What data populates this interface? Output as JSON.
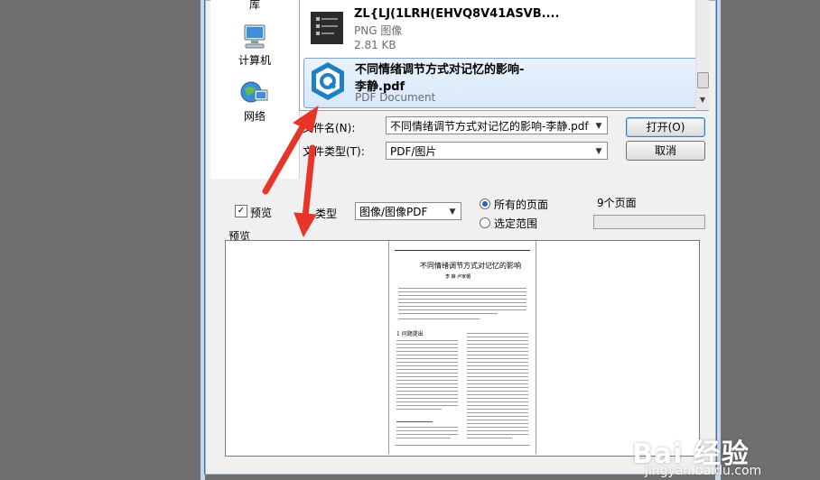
{
  "nav": {
    "items": [
      {
        "label": "库",
        "icon": "library-icon"
      },
      {
        "label": "计算机",
        "icon": "computer-icon"
      },
      {
        "label": "网络",
        "icon": "network-icon"
      }
    ]
  },
  "files": [
    {
      "name": "ZL{LJ(1LRH(EHVQ8V41ASVB....",
      "type": "PNG 图像",
      "size": "2.81 KB"
    },
    {
      "name_line1": "不同情绪调节方式对记忆的影响-",
      "name_line2": "李静.pdf",
      "type": "PDF Document"
    }
  ],
  "filename": {
    "label": "文件名(N):",
    "value": "不同情绪调节方式对记忆的影响-李静.pdf"
  },
  "filetype": {
    "label": "文件类型(T):",
    "value": "PDF/图片"
  },
  "buttons": {
    "open": "打开(O)",
    "cancel": "取消"
  },
  "options": {
    "preview_label": "预览",
    "preview_checked": true,
    "type_label": "类型",
    "type_value": "图像/图像PDF",
    "all_pages": "所有的页面",
    "selected_range": "选定范围",
    "page_count": "9个页面"
  },
  "preview": {
    "section_label": "预览",
    "doc_title": "不同情绪调节方式对记忆的影响",
    "authors": "李 静    卢家楣",
    "section_heading": "1 问题提出"
  },
  "watermark": {
    "main": "Bai 经验",
    "sub": "jingyan.baidu.com"
  },
  "colors": {
    "accent": "#3a6ea5",
    "selection": "#d7e8fb",
    "arrow": "#e8352a"
  }
}
